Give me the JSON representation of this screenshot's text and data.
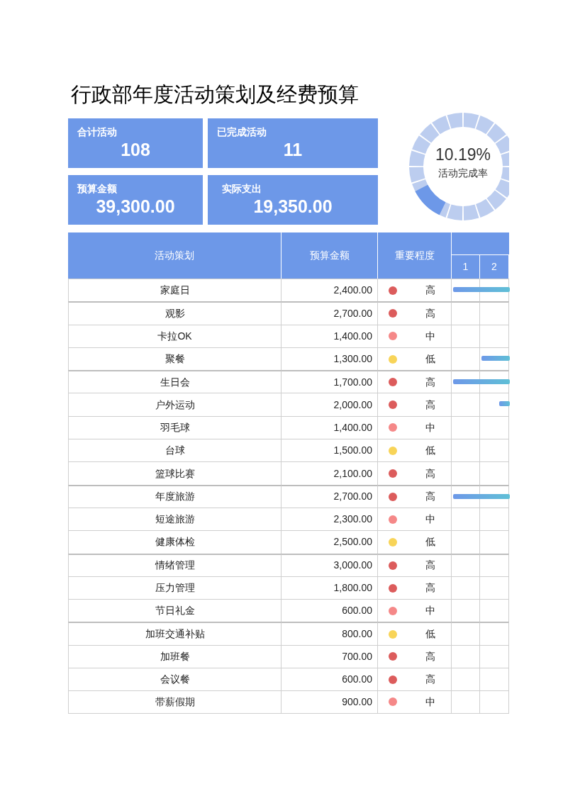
{
  "title": "行政部年度活动策划及经费预算",
  "cards": [
    {
      "label": "合计活动",
      "value": "108"
    },
    {
      "label": "已完成活动",
      "value": "11"
    },
    {
      "label": "预算金额",
      "value": "39,300.00"
    },
    {
      "label": "实际支出",
      "value": "19,350.00"
    }
  ],
  "donut": {
    "rate": "10.19%",
    "label": "活动完成率"
  },
  "table": {
    "columns": [
      "活动策划",
      "预算金额",
      "重要程度"
    ],
    "days": [
      "1",
      "2"
    ],
    "rows": [
      {
        "name": "家庭日",
        "amount": "2,400.00",
        "importance": "高",
        "color": "#dc5c5c",
        "group_start": false,
        "kind": "full"
      },
      {
        "name": "观影",
        "amount": "2,700.00",
        "importance": "高",
        "color": "#dc5c5c",
        "group_start": true,
        "kind": "plain"
      },
      {
        "name": "卡拉OK",
        "amount": "1,400.00",
        "importance": "中",
        "color": "#f58888",
        "group_start": false,
        "kind": "plain"
      },
      {
        "name": "聚餐",
        "amount": "1,300.00",
        "importance": "低",
        "color": "#f8d458",
        "group_start": false,
        "kind": "second"
      },
      {
        "name": "生日会",
        "amount": "1,700.00",
        "importance": "高",
        "color": "#dc5c5c",
        "group_start": true,
        "kind": "full"
      },
      {
        "name": "户外运动",
        "amount": "2,000.00",
        "importance": "高",
        "color": "#dc5c5c",
        "group_start": false,
        "kind": "late"
      },
      {
        "name": "羽毛球",
        "amount": "1,400.00",
        "importance": "中",
        "color": "#f58888",
        "group_start": false,
        "kind": "plain"
      },
      {
        "name": "台球",
        "amount": "1,500.00",
        "importance": "低",
        "color": "#f8d458",
        "group_start": false,
        "kind": "plain"
      },
      {
        "name": "篮球比赛",
        "amount": "2,100.00",
        "importance": "高",
        "color": "#dc5c5c",
        "group_start": false,
        "kind": "plain"
      },
      {
        "name": "年度旅游",
        "amount": "2,700.00",
        "importance": "高",
        "color": "#dc5c5c",
        "group_start": true,
        "kind": "full"
      },
      {
        "name": "短途旅游",
        "amount": "2,300.00",
        "importance": "中",
        "color": "#f58888",
        "group_start": false,
        "kind": "plain"
      },
      {
        "name": "健康体检",
        "amount": "2,500.00",
        "importance": "低",
        "color": "#f8d458",
        "group_start": false,
        "kind": "plain"
      },
      {
        "name": "情绪管理",
        "amount": "3,000.00",
        "importance": "高",
        "color": "#dc5c5c",
        "group_start": true,
        "kind": "plain"
      },
      {
        "name": "压力管理",
        "amount": "1,800.00",
        "importance": "高",
        "color": "#dc5c5c",
        "group_start": false,
        "kind": "plain"
      },
      {
        "name": "节日礼金",
        "amount": "600.00",
        "importance": "中",
        "color": "#f58888",
        "group_start": false,
        "kind": "plain"
      },
      {
        "name": "加班交通补贴",
        "amount": "800.00",
        "importance": "低",
        "color": "#f8d458",
        "group_start": true,
        "kind": "plain"
      },
      {
        "name": "加班餐",
        "amount": "700.00",
        "importance": "高",
        "color": "#dc5c5c",
        "group_start": false,
        "kind": "plain"
      },
      {
        "name": "会议餐",
        "amount": "600.00",
        "importance": "高",
        "color": "#dc5c5c",
        "group_start": false,
        "kind": "plain"
      },
      {
        "name": "带薪假期",
        "amount": "900.00",
        "importance": "中",
        "color": "#f58888",
        "group_start": false,
        "kind": "plain"
      }
    ]
  }
}
